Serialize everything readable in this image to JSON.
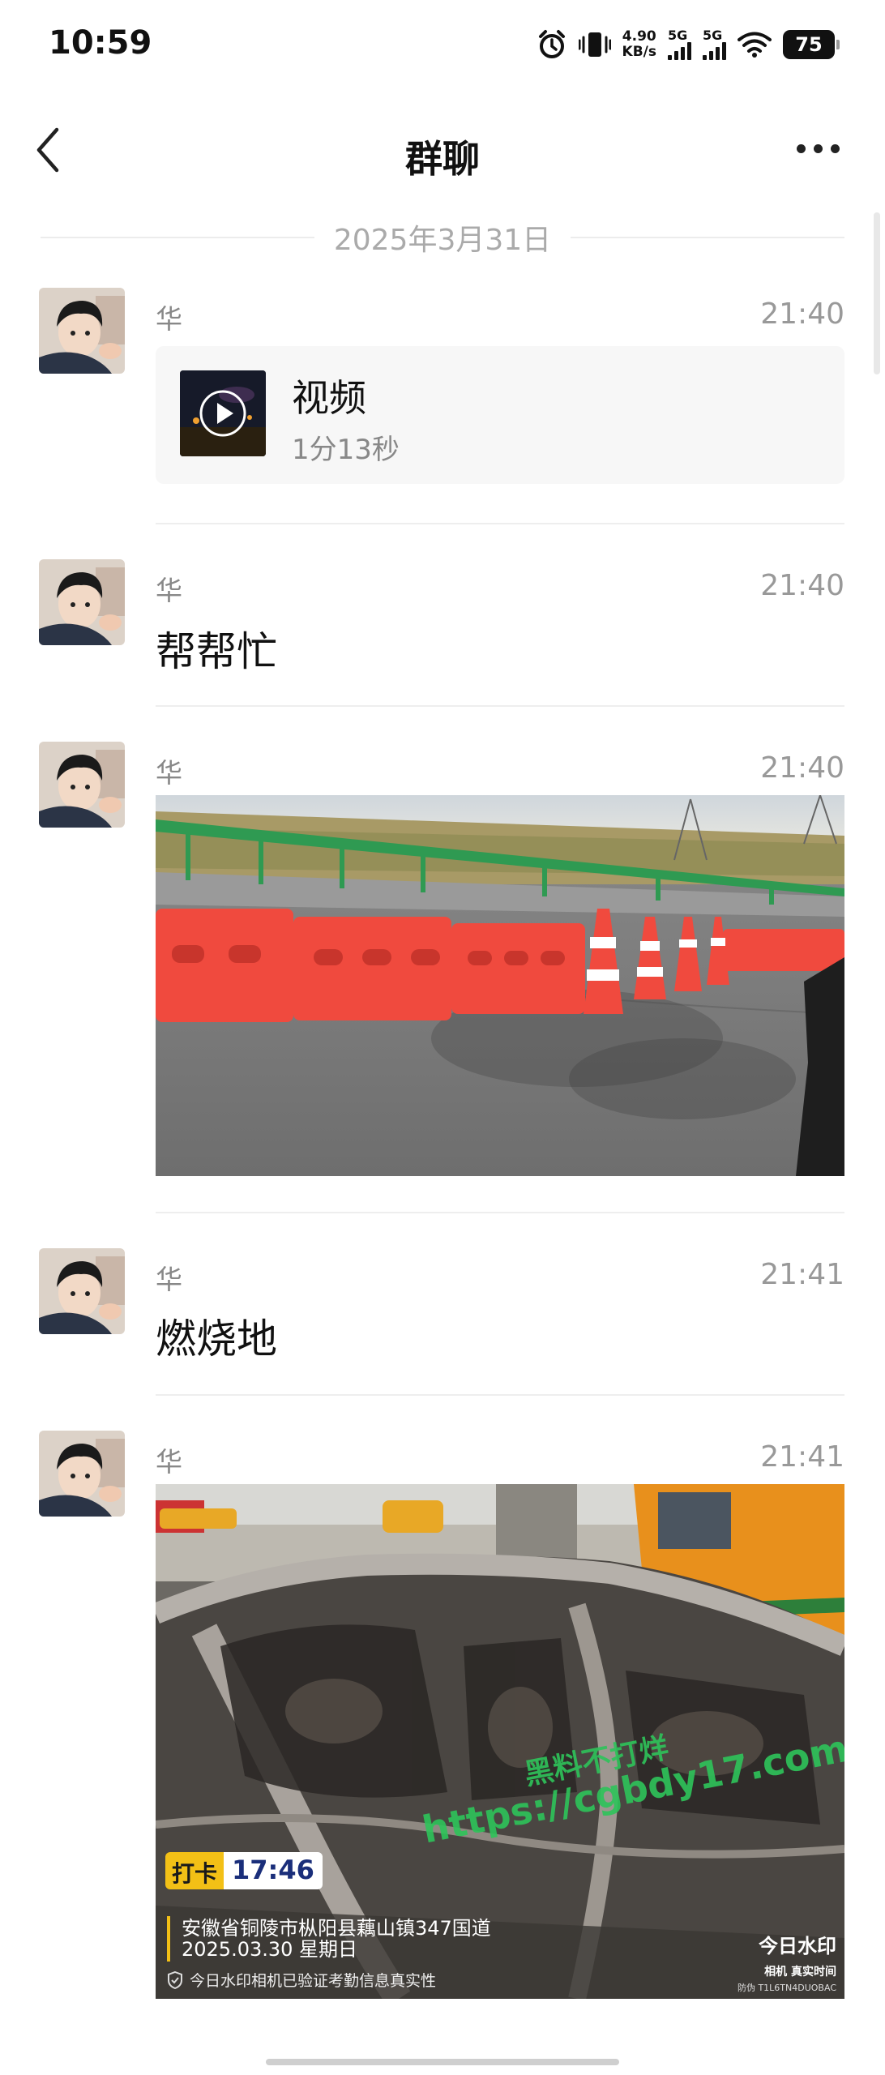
{
  "status_bar": {
    "time": "10:59",
    "net_speed_value": "4.90",
    "net_speed_unit": "KB/s",
    "sim1": "5G",
    "sim2": "5G",
    "battery": "75"
  },
  "nav": {
    "title": "群聊"
  },
  "date_separator": "2025年3月31日",
  "messages": [
    {
      "sender": "华",
      "time": "21:40",
      "type": "video",
      "video_title": "视频",
      "video_duration": "1分13秒"
    },
    {
      "sender": "华",
      "time": "21:40",
      "type": "text",
      "text": "帮帮忙"
    },
    {
      "sender": "华",
      "time": "21:40",
      "type": "image"
    },
    {
      "sender": "华",
      "time": "21:41",
      "type": "text",
      "text": "燃烧地"
    },
    {
      "sender": "华",
      "time": "21:41",
      "type": "image",
      "watermark": {
        "tag": "打卡",
        "clock": "17:46",
        "location": "安徽省铜陵市枞阳县藕山镇347国道",
        "date": "2025.03.30 星期日",
        "verify": "今日水印相机已验证考勤信息真实性",
        "brand": "今日水印",
        "brand_sub": "相机 真实时间",
        "id": "防伪 T1L6TN4DUOBAC",
        "overlay_line1": "黑料不打烊",
        "overlay_line2": "https://cgbdy17.com"
      }
    }
  ]
}
